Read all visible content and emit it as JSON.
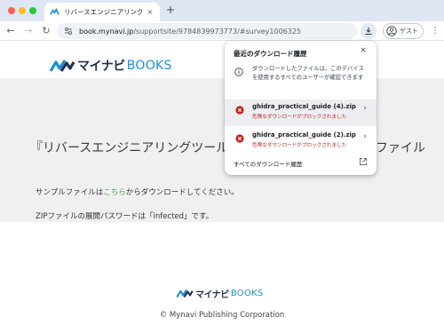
{
  "browser": {
    "tab": {
      "title": "リバースエンジニアリングツール",
      "close": "×"
    },
    "new_tab": "+",
    "nav": {
      "back": "←",
      "forward": "→",
      "reload": "↻"
    },
    "url": {
      "host": "book.mynavi.jp",
      "path": "/supportsite/9784839973773/#survey1006325"
    },
    "profile_label": "ゲスト",
    "menu": "⋮"
  },
  "page": {
    "logo": {
      "text": "マイナビ",
      "books": "BOOKS"
    },
    "hero_title": "『リバースエンジニアリングツールG",
    "hero_title_end": "ファイル",
    "body": {
      "line1_before": "サンプルファイルは",
      "line1_link": "こちら",
      "line1_after": "からダウンロードしてください。",
      "line2": "ZIPファイルの展開パスワードは「infected」です。"
    },
    "copyright": "© Mynavi Publishing Corporation"
  },
  "downloads": {
    "title": "最近のダウンロード履歴",
    "close": "×",
    "info_text": "ダウンロードしたファイルは、このデバイスを使用するすべてのユーザーが確認できます",
    "items": [
      {
        "filename": "ghidra_practical_guide (4).zip",
        "status": "危険なダウンロードがブロックされました",
        "chevron": "›"
      },
      {
        "filename": "ghidra_practical_guide (2).zip",
        "status": "危険なダウンロードがブロックされました",
        "chevron": "›"
      }
    ],
    "all_label": "すべてのダウンロード履歴"
  },
  "colors": {
    "error": "#c5221f",
    "link": "#53a55a",
    "brand_blue": "#1e8fd4",
    "brand_navy": "#21314d"
  },
  "icons": {
    "info": "info-circle-icon",
    "error": "error-circle-icon",
    "download": "download-icon",
    "open_external": "open-external-icon",
    "site_info": "tune-icon"
  }
}
